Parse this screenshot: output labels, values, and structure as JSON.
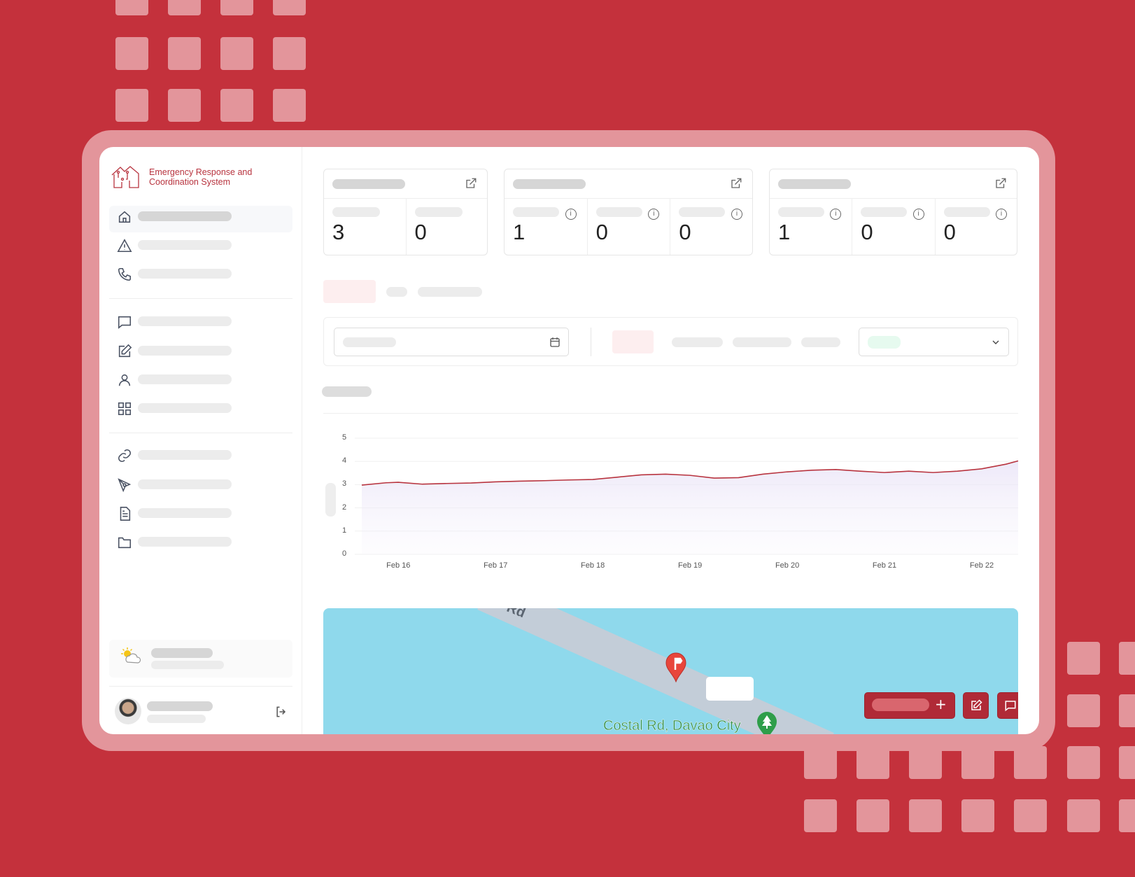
{
  "brand": {
    "title_line1": "Emergency Response and",
    "title_line2": "Coordination System",
    "color": "#b8343f"
  },
  "colors": {
    "background": "#c4313c",
    "accent_light": "#e3959b",
    "line": "#b8343f",
    "map_water": "#8fd9ec"
  },
  "sidebar": {
    "items": [
      {
        "icon": "home-icon"
      },
      {
        "icon": "alert-triangle-icon"
      },
      {
        "icon": "phone-icon"
      },
      {
        "icon": "message-icon"
      },
      {
        "icon": "edit-icon"
      },
      {
        "icon": "user-icon"
      },
      {
        "icon": "grid-icon"
      },
      {
        "icon": "link-icon"
      },
      {
        "icon": "pen-tool-icon"
      },
      {
        "icon": "document-icon"
      },
      {
        "icon": "folder-icon"
      }
    ],
    "weather_icon": "partly-sunny-icon",
    "logout_icon": "logout-icon"
  },
  "stats": [
    {
      "values": [
        "3",
        "0"
      ]
    },
    {
      "values": [
        "1",
        "0",
        "0"
      ]
    },
    {
      "values": [
        "1",
        "0",
        "0"
      ]
    }
  ],
  "chart_data": {
    "type": "area",
    "ylim": [
      0,
      5
    ],
    "y_ticks": [
      "0",
      "1",
      "2",
      "3",
      "4",
      "5"
    ],
    "x_ticks": [
      "Feb 16",
      "Feb 17",
      "Feb 18",
      "Feb 19",
      "Feb 20",
      "Feb 21",
      "Feb 22"
    ],
    "grid": true,
    "series": [
      {
        "x": [
          "Feb 15 15:00",
          "Feb 15 21:00",
          "Feb 16 00:00",
          "Feb 16 06:00",
          "Feb 16 12:00",
          "Feb 16 18:00",
          "Feb 17 00:00",
          "Feb 17 06:00",
          "Feb 17 12:00",
          "Feb 17 18:00",
          "Feb 18 00:00",
          "Feb 18 06:00",
          "Feb 18 12:00",
          "Feb 18 18:00",
          "Feb 19 00:00",
          "Feb 19 06:00",
          "Feb 19 12:00",
          "Feb 19 18:00",
          "Feb 20 00:00",
          "Feb 20 06:00",
          "Feb 20 12:00",
          "Feb 20 18:00",
          "Feb 21 00:00",
          "Feb 21 06:00",
          "Feb 21 12:00",
          "Feb 21 18:00",
          "Feb 22 00:00",
          "Feb 22 06:00",
          "Feb 22 09:00"
        ],
        "y": [
          2.98,
          3.08,
          3.1,
          3.02,
          3.05,
          3.07,
          3.12,
          3.15,
          3.17,
          3.2,
          3.22,
          3.32,
          3.42,
          3.45,
          3.4,
          3.28,
          3.3,
          3.45,
          3.55,
          3.62,
          3.65,
          3.58,
          3.52,
          3.58,
          3.52,
          3.58,
          3.68,
          3.88,
          4.02
        ]
      }
    ]
  },
  "map": {
    "road_label": "Rd",
    "place_label": "Costal Rd, Davao City",
    "actions": [
      {
        "icon": "plus-icon",
        "label": "+"
      },
      {
        "icon": "edit-icon"
      },
      {
        "icon": "message-icon"
      }
    ]
  }
}
